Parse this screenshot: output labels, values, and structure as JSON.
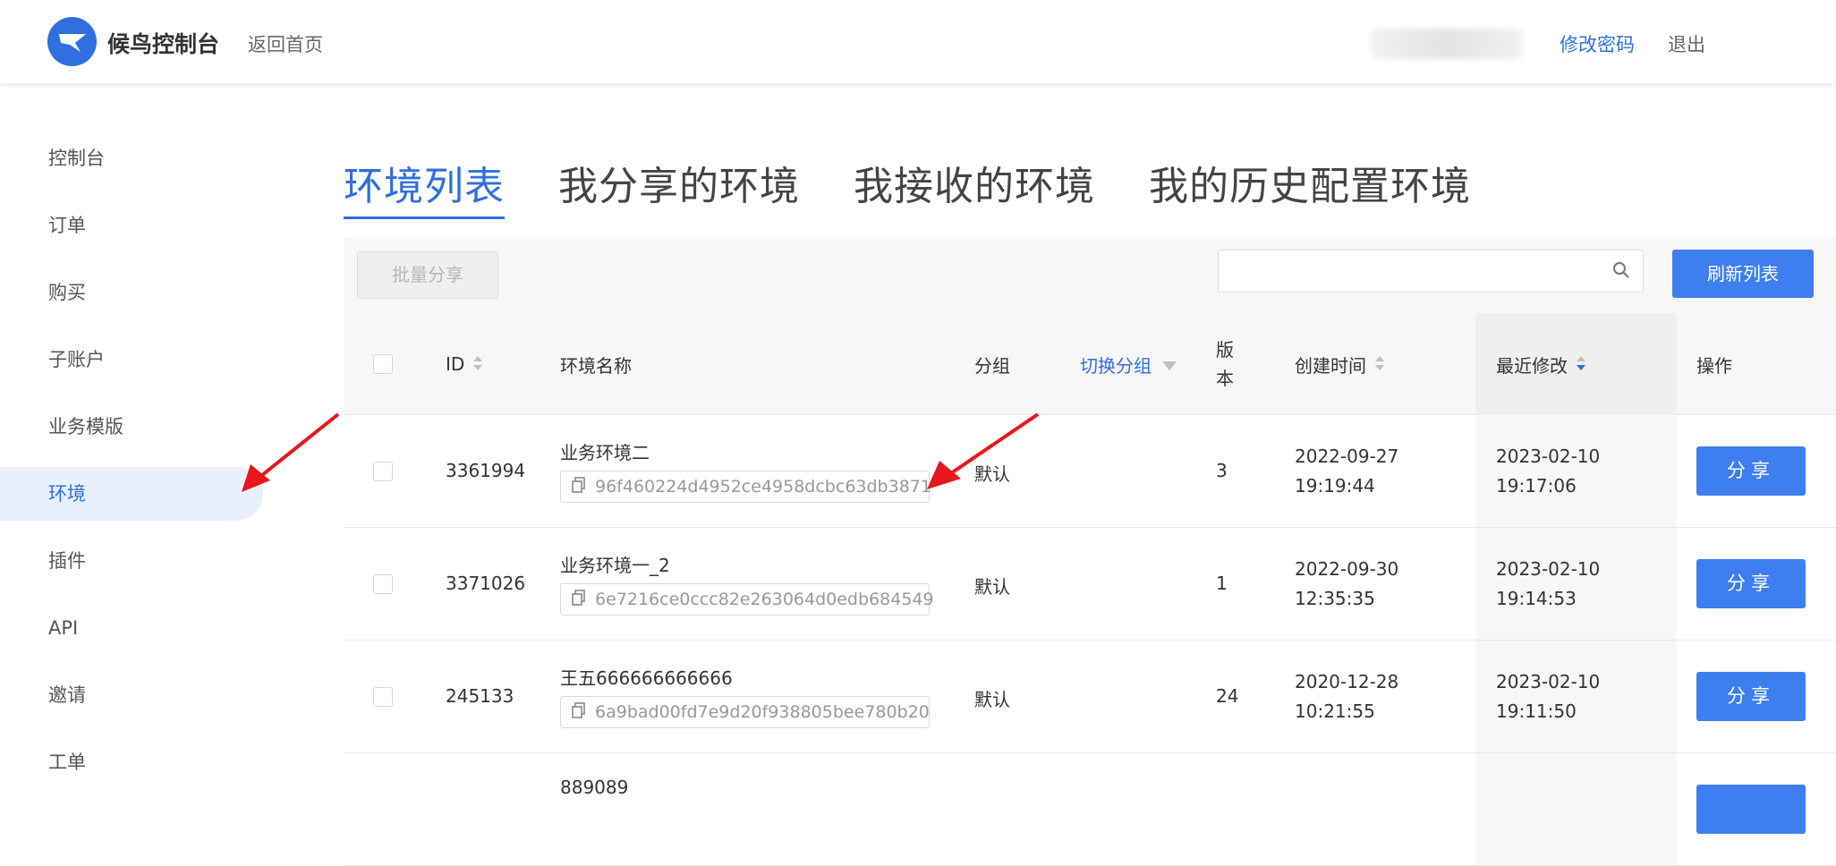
{
  "header": {
    "brand": "候鸟控制台",
    "back_home": "返回首页",
    "change_password": "修改密码",
    "logout": "退出"
  },
  "sidebar": {
    "items": [
      {
        "label": "控制台"
      },
      {
        "label": "订单"
      },
      {
        "label": "购买"
      },
      {
        "label": "子账户"
      },
      {
        "label": "业务模版"
      },
      {
        "label": "环境",
        "active": true
      },
      {
        "label": "插件"
      },
      {
        "label": "API"
      },
      {
        "label": "邀请"
      },
      {
        "label": "工单"
      }
    ]
  },
  "tabs": [
    {
      "label": "环境列表",
      "active": true
    },
    {
      "label": "我分享的环境"
    },
    {
      "label": "我接收的环境"
    },
    {
      "label": "我的历史配置环境"
    }
  ],
  "toolbar": {
    "batch_share": "批量分享",
    "search_value": "",
    "refresh": "刷新列表"
  },
  "table": {
    "headers": {
      "id": "ID",
      "name": "环境名称",
      "group": "分组",
      "switch_group": "切换分组",
      "version_line1": "版",
      "version_line2": "本",
      "created": "创建时间",
      "modified": "最近修改",
      "actions": "操作"
    },
    "rows": [
      {
        "id": "3361994",
        "name": "业务环境二",
        "uuid": "96f460224d4952ce4958dcbc63db3871",
        "group": "默认",
        "version": "3",
        "created_date": "2022-09-27",
        "created_time": "19:19:44",
        "modified_date": "2023-02-10",
        "modified_time": "19:17:06",
        "action": "分享"
      },
      {
        "id": "3371026",
        "name": "业务环境一_2",
        "uuid": "6e7216ce0ccc82e263064d0edb684549",
        "group": "默认",
        "version": "1",
        "created_date": "2022-09-30",
        "created_time": "12:35:35",
        "modified_date": "2023-02-10",
        "modified_time": "19:14:53",
        "action": "分享"
      },
      {
        "id": "245133",
        "name": "王五666666666666",
        "uuid": "6a9bad00fd7e9d20f938805bee780b20",
        "group": "默认",
        "version": "24",
        "created_date": "2020-12-28",
        "created_time": "10:21:55",
        "modified_date": "2023-02-10",
        "modified_time": "19:11:50",
        "action": "分享"
      },
      {
        "name": "889089"
      }
    ]
  },
  "colors": {
    "accent": "#2f6fe0",
    "button_blue": "#3d7ff0",
    "annotation_red": "#e8161c"
  }
}
